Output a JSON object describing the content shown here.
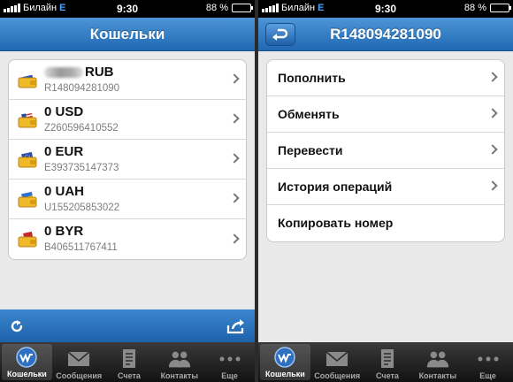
{
  "status_bar": {
    "carrier": "Билайн",
    "network": "E",
    "time": "9:30",
    "battery": "88 %"
  },
  "screen_left": {
    "title": "Кошельки",
    "wallets": [
      {
        "title": "RUB",
        "id": "R148094281090",
        "icon": "wallet-russia-flag-icon",
        "flag_colors": [
          "#ffffff",
          "#1f4fbf",
          "#d42a2a"
        ]
      },
      {
        "title": "0 USD",
        "id": "Z260596410552",
        "icon": "wallet-usa-flag-icon",
        "flag_colors": [
          "#c9302c",
          "#ffffff",
          "#2a4a9c"
        ]
      },
      {
        "title": "0 EUR",
        "id": "E393735147373",
        "icon": "wallet-eu-flag-icon",
        "flag_colors": [
          "#2a4fb0",
          "#f2c200"
        ]
      },
      {
        "title": "0 UAH",
        "id": "U155205853022",
        "icon": "wallet-ukraine-flag-icon",
        "flag_colors": [
          "#2a6fd1",
          "#f4d200"
        ]
      },
      {
        "title": "0 BYR",
        "id": "B406511767411",
        "icon": "wallet-belarus-flag-icon",
        "flag_colors": [
          "#c8262d",
          "#3c9a3c"
        ]
      }
    ],
    "toolbar": {
      "left_icon": "refresh-icon",
      "right_icon": "share-icon"
    }
  },
  "screen_right": {
    "title": "R148094281090",
    "back_icon": "back-arrow-icon",
    "actions": [
      {
        "label": "Пополнить",
        "chevron": true
      },
      {
        "label": "Обменять",
        "chevron": true
      },
      {
        "label": "Перевести",
        "chevron": true
      },
      {
        "label": "История операций",
        "chevron": true
      },
      {
        "label": "Копировать номер",
        "chevron": false
      }
    ]
  },
  "tabs": [
    {
      "label": "Кошельки",
      "icon": "webmoney-globe-icon",
      "active": true
    },
    {
      "label": "Сообщения",
      "icon": "envelope-icon",
      "active": false
    },
    {
      "label": "Счета",
      "icon": "receipt-icon",
      "active": false
    },
    {
      "label": "Контакты",
      "icon": "contacts-icon",
      "active": false
    },
    {
      "label": "Еще",
      "icon": "more-dots-icon",
      "active": false
    }
  ],
  "colors": {
    "navbar": "#2f7bc4",
    "tabbar": "#1e1e1e",
    "background": "#e9e9ea",
    "wallet_gold": "#f0b92a"
  }
}
